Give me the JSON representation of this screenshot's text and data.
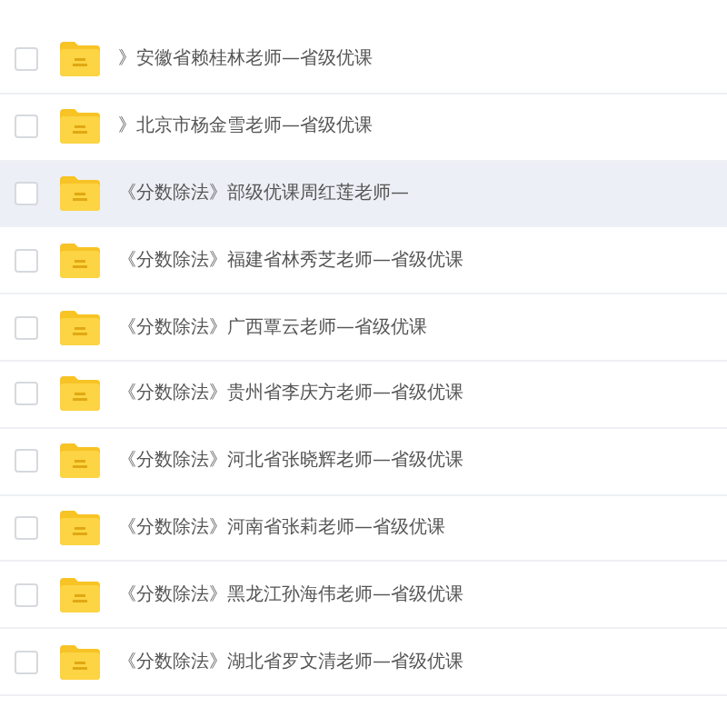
{
  "files": [
    {
      "name": "》安徽省赖桂林老师—省级优课",
      "hovered": false
    },
    {
      "name": "》北京市杨金雪老师—省级优课",
      "hovered": false
    },
    {
      "name": "《分数除法》部级优课周红莲老师—",
      "hovered": true
    },
    {
      "name": "《分数除法》福建省林秀芝老师—省级优课",
      "hovered": false
    },
    {
      "name": "《分数除法》广西覃云老师—省级优课",
      "hovered": false
    },
    {
      "name": "《分数除法》贵州省李庆方老师—省级优课",
      "hovered": false
    },
    {
      "name": "《分数除法》河北省张晓辉老师—省级优课",
      "hovered": false
    },
    {
      "name": "《分数除法》河南省张莉老师—省级优课",
      "hovered": false
    },
    {
      "name": "《分数除法》黑龙江孙海伟老师—省级优课",
      "hovered": false
    },
    {
      "name": "《分数除法》湖北省罗文清老师—省级优课",
      "hovered": false
    }
  ]
}
